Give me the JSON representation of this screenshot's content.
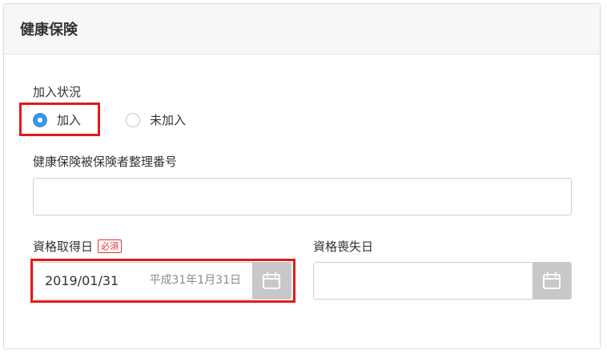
{
  "card": {
    "title": "健康保険"
  },
  "enrollment": {
    "label": "加入状況",
    "options": [
      {
        "label": "加入",
        "checked": true
      },
      {
        "label": "未加入",
        "checked": false
      }
    ]
  },
  "insured_number": {
    "label": "健康保険被保険者整理番号",
    "value": ""
  },
  "acquisition_date": {
    "label": "資格取得日",
    "required_badge": "必須",
    "value": "2019/01/31",
    "wareki": "平成31年1月31日",
    "icon": "calendar-icon"
  },
  "loss_date": {
    "label": "資格喪失日",
    "value": "",
    "icon": "calendar-icon"
  },
  "colors": {
    "accent": "#3a97dd",
    "highlight": "#e31a1a",
    "required": "#e23232",
    "calendar_button": "#c8c8c8"
  }
}
